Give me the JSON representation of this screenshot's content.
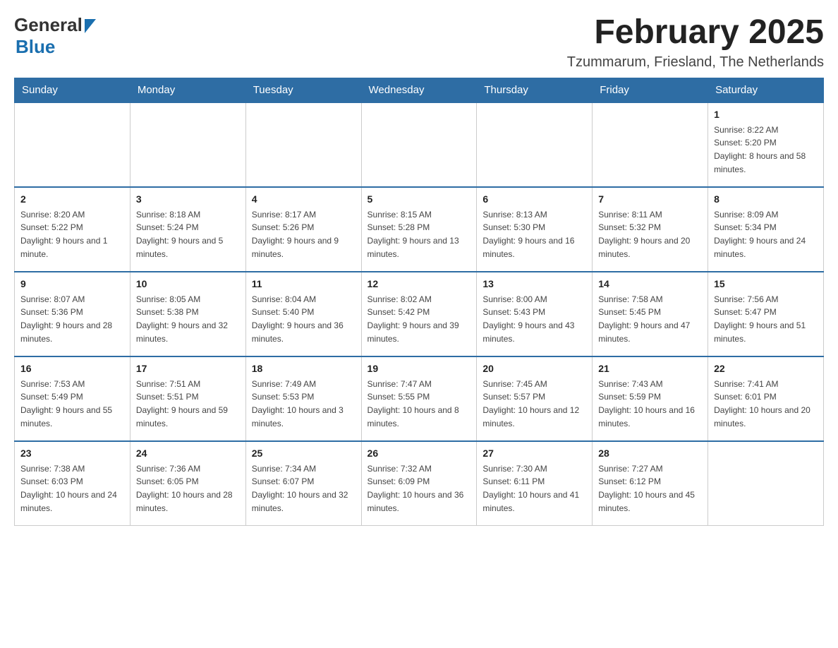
{
  "header": {
    "logo": {
      "general": "General",
      "blue": "Blue"
    },
    "title": "February 2025",
    "location": "Tzummarum, Friesland, The Netherlands"
  },
  "calendar": {
    "days_of_week": [
      "Sunday",
      "Monday",
      "Tuesday",
      "Wednesday",
      "Thursday",
      "Friday",
      "Saturday"
    ],
    "weeks": [
      [
        {
          "day": "",
          "info": ""
        },
        {
          "day": "",
          "info": ""
        },
        {
          "day": "",
          "info": ""
        },
        {
          "day": "",
          "info": ""
        },
        {
          "day": "",
          "info": ""
        },
        {
          "day": "",
          "info": ""
        },
        {
          "day": "1",
          "info": "Sunrise: 8:22 AM\nSunset: 5:20 PM\nDaylight: 8 hours and 58 minutes."
        }
      ],
      [
        {
          "day": "2",
          "info": "Sunrise: 8:20 AM\nSunset: 5:22 PM\nDaylight: 9 hours and 1 minute."
        },
        {
          "day": "3",
          "info": "Sunrise: 8:18 AM\nSunset: 5:24 PM\nDaylight: 9 hours and 5 minutes."
        },
        {
          "day": "4",
          "info": "Sunrise: 8:17 AM\nSunset: 5:26 PM\nDaylight: 9 hours and 9 minutes."
        },
        {
          "day": "5",
          "info": "Sunrise: 8:15 AM\nSunset: 5:28 PM\nDaylight: 9 hours and 13 minutes."
        },
        {
          "day": "6",
          "info": "Sunrise: 8:13 AM\nSunset: 5:30 PM\nDaylight: 9 hours and 16 minutes."
        },
        {
          "day": "7",
          "info": "Sunrise: 8:11 AM\nSunset: 5:32 PM\nDaylight: 9 hours and 20 minutes."
        },
        {
          "day": "8",
          "info": "Sunrise: 8:09 AM\nSunset: 5:34 PM\nDaylight: 9 hours and 24 minutes."
        }
      ],
      [
        {
          "day": "9",
          "info": "Sunrise: 8:07 AM\nSunset: 5:36 PM\nDaylight: 9 hours and 28 minutes."
        },
        {
          "day": "10",
          "info": "Sunrise: 8:05 AM\nSunset: 5:38 PM\nDaylight: 9 hours and 32 minutes."
        },
        {
          "day": "11",
          "info": "Sunrise: 8:04 AM\nSunset: 5:40 PM\nDaylight: 9 hours and 36 minutes."
        },
        {
          "day": "12",
          "info": "Sunrise: 8:02 AM\nSunset: 5:42 PM\nDaylight: 9 hours and 39 minutes."
        },
        {
          "day": "13",
          "info": "Sunrise: 8:00 AM\nSunset: 5:43 PM\nDaylight: 9 hours and 43 minutes."
        },
        {
          "day": "14",
          "info": "Sunrise: 7:58 AM\nSunset: 5:45 PM\nDaylight: 9 hours and 47 minutes."
        },
        {
          "day": "15",
          "info": "Sunrise: 7:56 AM\nSunset: 5:47 PM\nDaylight: 9 hours and 51 minutes."
        }
      ],
      [
        {
          "day": "16",
          "info": "Sunrise: 7:53 AM\nSunset: 5:49 PM\nDaylight: 9 hours and 55 minutes."
        },
        {
          "day": "17",
          "info": "Sunrise: 7:51 AM\nSunset: 5:51 PM\nDaylight: 9 hours and 59 minutes."
        },
        {
          "day": "18",
          "info": "Sunrise: 7:49 AM\nSunset: 5:53 PM\nDaylight: 10 hours and 3 minutes."
        },
        {
          "day": "19",
          "info": "Sunrise: 7:47 AM\nSunset: 5:55 PM\nDaylight: 10 hours and 8 minutes."
        },
        {
          "day": "20",
          "info": "Sunrise: 7:45 AM\nSunset: 5:57 PM\nDaylight: 10 hours and 12 minutes."
        },
        {
          "day": "21",
          "info": "Sunrise: 7:43 AM\nSunset: 5:59 PM\nDaylight: 10 hours and 16 minutes."
        },
        {
          "day": "22",
          "info": "Sunrise: 7:41 AM\nSunset: 6:01 PM\nDaylight: 10 hours and 20 minutes."
        }
      ],
      [
        {
          "day": "23",
          "info": "Sunrise: 7:38 AM\nSunset: 6:03 PM\nDaylight: 10 hours and 24 minutes."
        },
        {
          "day": "24",
          "info": "Sunrise: 7:36 AM\nSunset: 6:05 PM\nDaylight: 10 hours and 28 minutes."
        },
        {
          "day": "25",
          "info": "Sunrise: 7:34 AM\nSunset: 6:07 PM\nDaylight: 10 hours and 32 minutes."
        },
        {
          "day": "26",
          "info": "Sunrise: 7:32 AM\nSunset: 6:09 PM\nDaylight: 10 hours and 36 minutes."
        },
        {
          "day": "27",
          "info": "Sunrise: 7:30 AM\nSunset: 6:11 PM\nDaylight: 10 hours and 41 minutes."
        },
        {
          "day": "28",
          "info": "Sunrise: 7:27 AM\nSunset: 6:12 PM\nDaylight: 10 hours and 45 minutes."
        },
        {
          "day": "",
          "info": ""
        }
      ]
    ]
  }
}
